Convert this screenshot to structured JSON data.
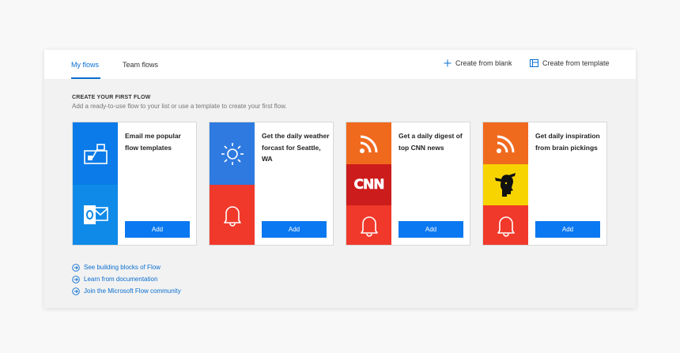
{
  "tabs": [
    {
      "label": "My flows",
      "active": true
    },
    {
      "label": "Team flows",
      "active": false
    }
  ],
  "actions": {
    "create_blank": "Create from blank",
    "create_template": "Create from template"
  },
  "section": {
    "title": "CREATE YOUR FIRST FLOW",
    "subtitle": "Add a ready-to-use flow to your list or use a template to create your first flow."
  },
  "cards": [
    {
      "title": "Email me popular flow templates",
      "add_label": "Add",
      "icons": [
        "flow-icon",
        "outlook-icon"
      ],
      "colors": [
        "#0a7be8",
        "#0f8ae8"
      ]
    },
    {
      "title": "Get the daily weather forcast for Seattle, WA",
      "add_label": "Add",
      "icons": [
        "weather-sun-icon",
        "notification-bell-icon"
      ],
      "colors": [
        "#2f7ae0",
        "#f0392b"
      ]
    },
    {
      "title": "Get a daily digest of top CNN news",
      "add_label": "Add",
      "icons": [
        "rss-icon",
        "cnn-logo",
        "notification-bell-icon"
      ],
      "colors": [
        "#f06a1e",
        "#cc1c1c",
        "#f0392b"
      ],
      "logo_text": "CNN"
    },
    {
      "title": "Get daily inspiration from brain pickings",
      "add_label": "Add",
      "icons": [
        "rss-icon",
        "brain-pickings-logo",
        "notification-bell-icon"
      ],
      "colors": [
        "#f06a1e",
        "#f7d400",
        "#f0392b"
      ]
    }
  ],
  "links": [
    "See building blocks of Flow",
    "Learn from documentation",
    "Join the Microsoft Flow community"
  ],
  "accent": "#0a6ed1"
}
